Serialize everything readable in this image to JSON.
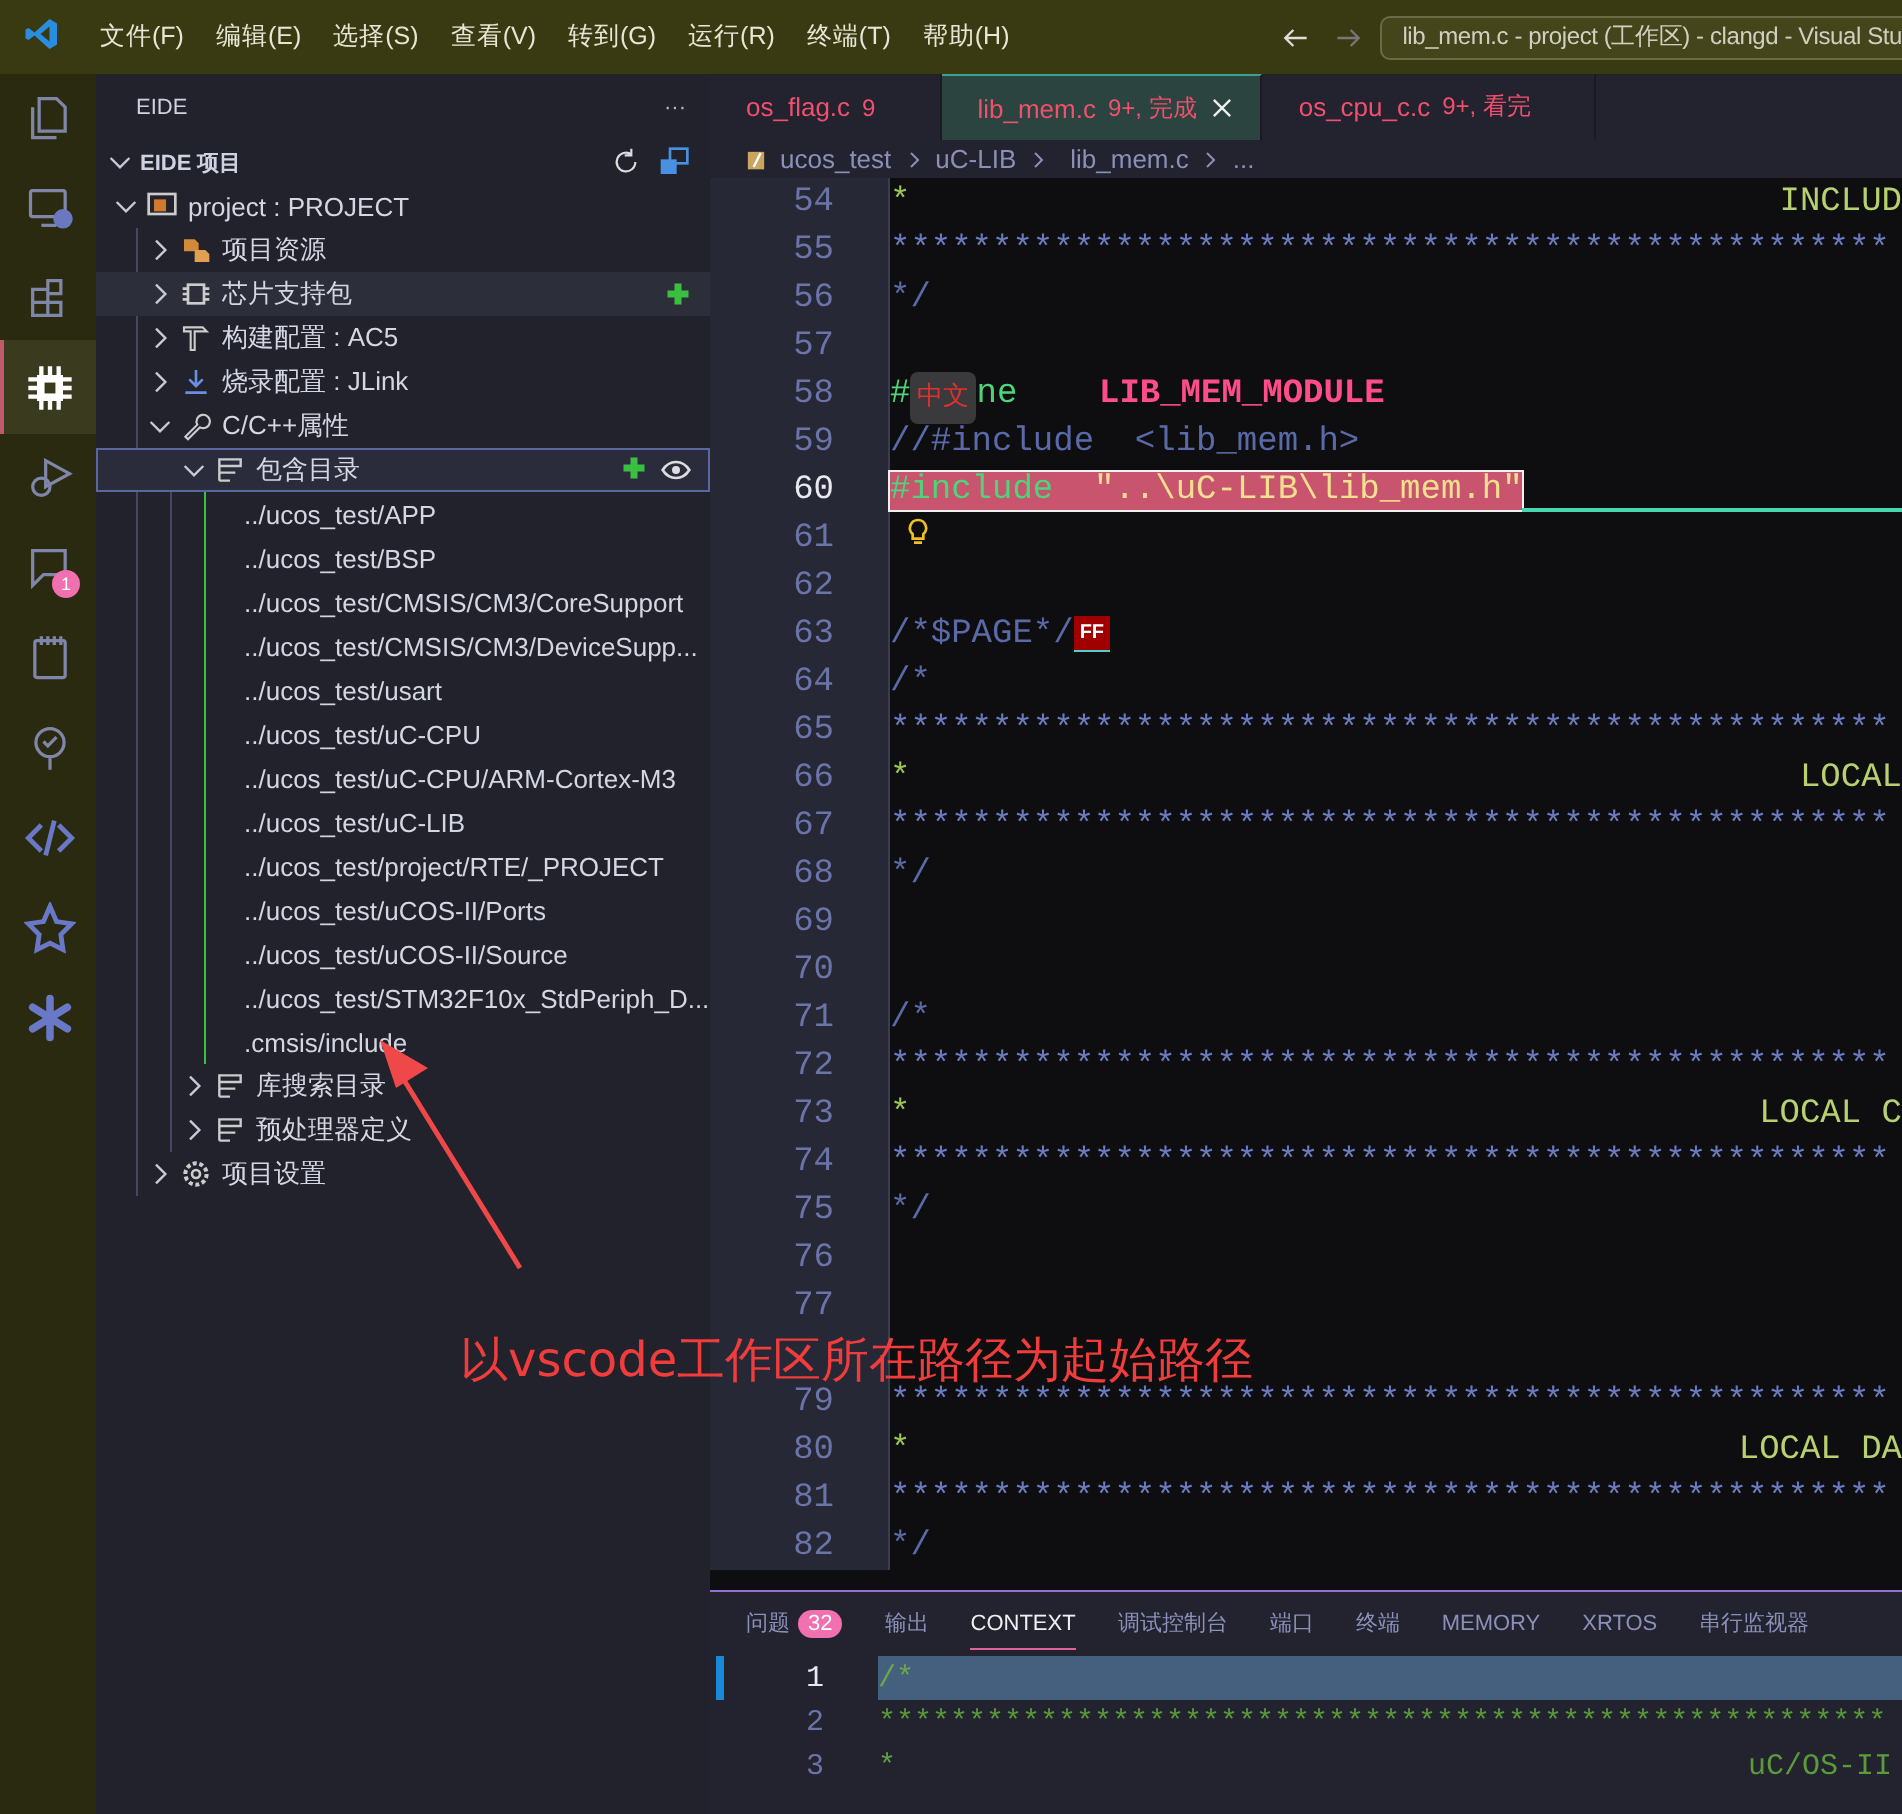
{
  "title_bar": {
    "menus": [
      "文件(F)",
      "编辑(E)",
      "选择(S)",
      "查看(V)",
      "转到(G)",
      "运行(R)",
      "终端(T)",
      "帮助(H)"
    ],
    "command_center": "lib_mem.c - project (工作区) - clangd - Visual Stu"
  },
  "activity_bar": [
    {
      "kind": "files",
      "selected": false
    },
    {
      "kind": "remote",
      "selected": false
    },
    {
      "kind": "extensions",
      "selected": false
    },
    {
      "kind": "chip",
      "selected": true
    },
    {
      "kind": "debug",
      "selected": false
    },
    {
      "kind": "comments",
      "selected": false,
      "badge": "1"
    },
    {
      "kind": "notebook",
      "selected": false
    },
    {
      "kind": "tree",
      "selected": false
    },
    {
      "kind": "code",
      "selected": false
    },
    {
      "kind": "star",
      "selected": false
    },
    {
      "kind": "flower",
      "selected": false
    }
  ],
  "sidebar": {
    "title": "EIDE",
    "more": "···",
    "section": {
      "title": "EIDE 项目",
      "expanded": true
    },
    "tree": [
      {
        "label": "project : PROJECT",
        "kind": "project",
        "expanded": true,
        "selected": false,
        "hovered": false,
        "children": [
          {
            "label": "项目资源",
            "kind": "resources",
            "expanded": false,
            "selected": false,
            "hovered": false
          },
          {
            "label": "芯片支持包",
            "kind": "package",
            "expanded": false,
            "selected": false,
            "hovered": true
          },
          {
            "label": "构建配置 : AC5",
            "kind": "build",
            "expanded": false,
            "selected": false,
            "hovered": false
          },
          {
            "label": "烧录配置 : JLink",
            "kind": "flash",
            "expanded": false,
            "selected": false,
            "hovered": false
          },
          {
            "label": "C/C++属性",
            "kind": "properties",
            "expanded": true,
            "selected": false,
            "hovered": false,
            "children": [
              {
                "label": "包含目录",
                "kind": "group",
                "expanded": true,
                "selected": true,
                "hovered": false,
                "children": [
                  {
                    "label": "../ucos_test/APP",
                    "kind": "path",
                    "selected": false,
                    "hovered": false
                  },
                  {
                    "label": "../ucos_test/BSP",
                    "kind": "path",
                    "selected": false,
                    "hovered": false
                  },
                  {
                    "label": "../ucos_test/CMSIS/CM3/CoreSupport",
                    "kind": "path",
                    "selected": false,
                    "hovered": false
                  },
                  {
                    "label": "../ucos_test/CMSIS/CM3/DeviceSupp...",
                    "kind": "path",
                    "selected": false,
                    "hovered": false
                  },
                  {
                    "label": "../ucos_test/usart",
                    "kind": "path",
                    "selected": false,
                    "hovered": false
                  },
                  {
                    "label": "../ucos_test/uC-CPU",
                    "kind": "path",
                    "selected": false,
                    "hovered": false
                  },
                  {
                    "label": "../ucos_test/uC-CPU/ARM-Cortex-M3",
                    "kind": "path",
                    "selected": false,
                    "hovered": false
                  },
                  {
                    "label": "../ucos_test/uC-LIB",
                    "kind": "path",
                    "selected": false,
                    "hovered": false
                  },
                  {
                    "label": "../ucos_test/project/RTE/_PROJECT",
                    "kind": "path",
                    "selected": false,
                    "hovered": false
                  },
                  {
                    "label": "../ucos_test/uCOS-II/Ports",
                    "kind": "path",
                    "selected": false,
                    "hovered": false
                  },
                  {
                    "label": "../ucos_test/uCOS-II/Source",
                    "kind": "path",
                    "selected": false,
                    "hovered": false
                  },
                  {
                    "label": "../ucos_test/STM32F10x_StdPeriph_D...",
                    "kind": "path",
                    "selected": false,
                    "hovered": false
                  },
                  {
                    "label": ".cmsis/include",
                    "kind": "path",
                    "selected": false,
                    "hovered": false
                  }
                ]
              },
              {
                "label": "库搜索目录",
                "kind": "group",
                "expanded": false,
                "selected": false,
                "hovered": false
              },
              {
                "label": "预处理器定义",
                "kind": "group",
                "expanded": false,
                "selected": false,
                "hovered": false
              }
            ]
          },
          {
            "label": "项目设置",
            "kind": "settings",
            "expanded": false,
            "selected": false,
            "hovered": false
          }
        ]
      }
    ]
  },
  "tabs": [
    {
      "name": "os_flag.c",
      "status": "9",
      "selected": false
    },
    {
      "name": "lib_mem.c",
      "status": "9+, 完成",
      "selected": true
    },
    {
      "name": "os_cpu_c.c",
      "status": "9+, 看完",
      "selected": false
    }
  ],
  "breadcrumb": [
    {
      "label": "ucos_test",
      "kind": "workspace"
    },
    {
      "label": "uC-LIB",
      "kind": "folder"
    },
    {
      "label": "lib_mem.c",
      "kind": "cfile"
    },
    {
      "label": "...",
      "kind": "more"
    }
  ],
  "code": [
    {
      "number": "54",
      "kind": "code",
      "tokens": [
        {
          "text": "*",
          "kind": "star"
        }
      ],
      "right": "INCLUD"
    },
    {
      "number": "55",
      "kind": "code",
      "tokens": [
        {
          "text": "*************************************************",
          "kind": "rule"
        }
      ]
    },
    {
      "number": "56",
      "kind": "code",
      "tokens": [
        {
          "text": "*/",
          "kind": "comment"
        }
      ]
    },
    {
      "number": "57",
      "kind": "code"
    },
    {
      "number": "58",
      "kind": "code",
      "tokens": [
        {
          "text": "#",
          "kind": "directive"
        },
        {
          "text": "中文",
          "kind": "ime"
        },
        {
          "text": "ne    ",
          "kind": "directive"
        },
        {
          "text": "LIB_MEM_MODULE",
          "kind": "macro"
        }
      ]
    },
    {
      "number": "59",
      "kind": "code",
      "tokens": [
        {
          "text": "//#include  <lib_mem.h>",
          "kind": "comment"
        }
      ]
    },
    {
      "number": "60",
      "kind": "cursor",
      "tokens": [
        {
          "text": "#include  ",
          "kind": "directive"
        },
        {
          "text": "\"..\\uC-LIB\\lib_mem.h\"",
          "kind": "string"
        }
      ]
    },
    {
      "number": "61",
      "kind": "bulb"
    },
    {
      "number": "62",
      "kind": "code"
    },
    {
      "number": "63",
      "kind": "code",
      "tokens": [
        {
          "text": "/*$PAGE*/",
          "kind": "comment"
        },
        {
          "text": "FF",
          "kind": "control"
        }
      ]
    },
    {
      "number": "64",
      "kind": "code",
      "tokens": [
        {
          "text": "/*",
          "kind": "comment"
        }
      ]
    },
    {
      "number": "65",
      "kind": "code",
      "tokens": [
        {
          "text": "*************************************************",
          "kind": "rule"
        }
      ]
    },
    {
      "number": "66",
      "kind": "code",
      "tokens": [
        {
          "text": "*",
          "kind": "star"
        }
      ],
      "right": "LOCAL"
    },
    {
      "number": "67",
      "kind": "code",
      "tokens": [
        {
          "text": "*************************************************",
          "kind": "rule"
        }
      ]
    },
    {
      "number": "68",
      "kind": "code",
      "tokens": [
        {
          "text": "*/",
          "kind": "comment"
        }
      ]
    },
    {
      "number": "69",
      "kind": "code"
    },
    {
      "number": "70",
      "kind": "code"
    },
    {
      "number": "71",
      "kind": "code",
      "tokens": [
        {
          "text": "/*",
          "kind": "comment"
        }
      ]
    },
    {
      "number": "72",
      "kind": "code",
      "tokens": [
        {
          "text": "*************************************************",
          "kind": "rule"
        }
      ]
    },
    {
      "number": "73",
      "kind": "code",
      "tokens": [
        {
          "text": "*",
          "kind": "star"
        }
      ],
      "right": "LOCAL C"
    },
    {
      "number": "74",
      "kind": "code",
      "tokens": [
        {
          "text": "*************************************************",
          "kind": "rule"
        }
      ]
    },
    {
      "number": "75",
      "kind": "code",
      "tokens": [
        {
          "text": "*/",
          "kind": "comment"
        }
      ]
    },
    {
      "number": "76",
      "kind": "code"
    },
    {
      "number": "77",
      "kind": "code"
    },
    {
      "kind": "code"
    },
    {
      "number": "79",
      "kind": "code",
      "tokens": [
        {
          "text": "*************************************************",
          "kind": "rule"
        }
      ]
    },
    {
      "number": "80",
      "kind": "code",
      "tokens": [
        {
          "text": "*",
          "kind": "star"
        }
      ],
      "right": "LOCAL DA"
    },
    {
      "number": "81",
      "kind": "code",
      "tokens": [
        {
          "text": "*************************************************",
          "kind": "rule"
        }
      ]
    },
    {
      "number": "82",
      "kind": "code",
      "tokens": [
        {
          "text": "*/",
          "kind": "comment"
        }
      ]
    }
  ],
  "panel": {
    "tabs": [
      {
        "label": "问题",
        "badge": "32",
        "selected": false
      },
      {
        "label": "输出",
        "selected": false
      },
      {
        "label": "CONTEXT",
        "selected": true
      },
      {
        "label": "调试控制台",
        "selected": false
      },
      {
        "label": "端口",
        "selected": false
      },
      {
        "label": "终端",
        "selected": false
      },
      {
        "label": "MEMORY",
        "selected": false
      },
      {
        "label": "XRTOS",
        "selected": false
      },
      {
        "label": "串行监视器",
        "selected": false
      }
    ],
    "lines": [
      {
        "number": "1",
        "kind": "cursor",
        "tokens": [
          {
            "text": "/*",
            "kind": "comment"
          }
        ]
      },
      {
        "number": "2",
        "kind": "code",
        "tokens": [
          {
            "text": "********************************************************",
            "kind": "rule"
          }
        ]
      },
      {
        "number": "3",
        "kind": "code",
        "tokens": [
          {
            "text": "*",
            "kind": "star"
          }
        ],
        "right": "uC/OS-II"
      }
    ]
  },
  "annotation": {
    "text": "以vscode工作区所在路径为起始路径"
  }
}
